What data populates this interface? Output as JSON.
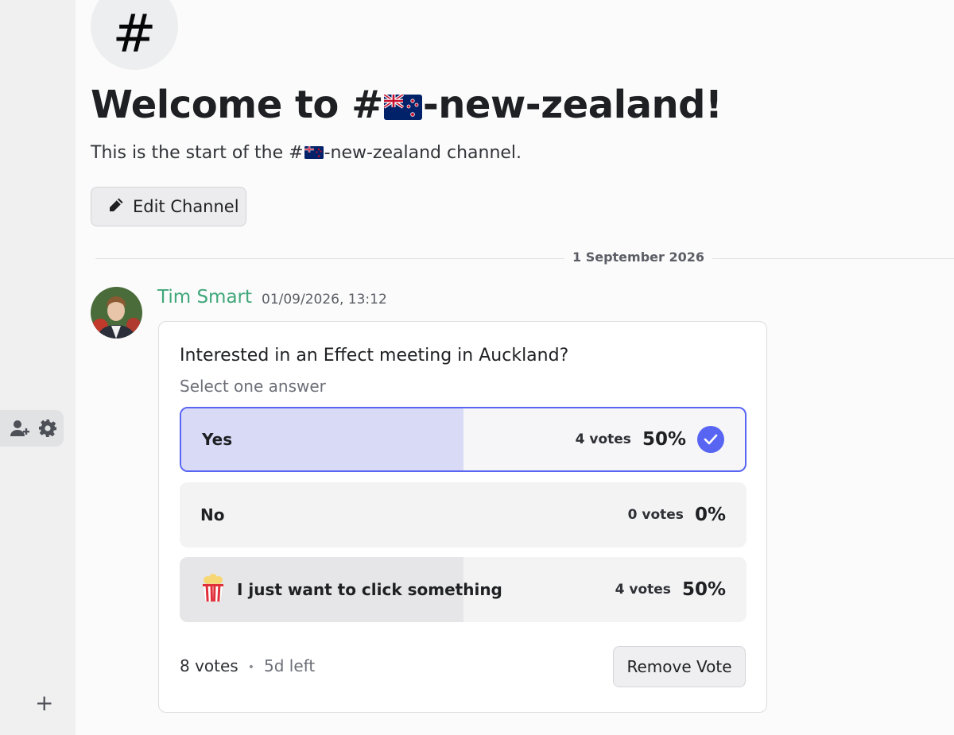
{
  "sidebar": {
    "icons": [
      "add-member-icon",
      "gear-icon"
    ],
    "add_label": "+"
  },
  "channel": {
    "icon_glyph": "#",
    "welcome_prefix": "Welcome to #",
    "welcome_suffix": "-new-zealand!",
    "desc_prefix": "This is the start of the #",
    "desc_suffix": "-new-zealand channel.",
    "flag_emoji": "🇳🇿",
    "edit_label": "Edit Channel"
  },
  "divider": {
    "date": "1 September 2026"
  },
  "message": {
    "author": "Tim Smart",
    "timestamp": "01/09/2026, 13:12",
    "author_color": "#3fa77a"
  },
  "poll": {
    "question": "Interested in an Effect meeting in Auckland?",
    "subtitle": "Select one answer",
    "options": [
      {
        "emoji": "",
        "label": "Yes",
        "votes": "4 votes",
        "percent": "50%",
        "fraction": 0.5,
        "selected": true
      },
      {
        "emoji": "",
        "label": "No",
        "votes": "0 votes",
        "percent": "0%",
        "fraction": 0,
        "selected": false
      },
      {
        "emoji": "🍿",
        "label": "I just want to click something",
        "votes": "4 votes",
        "percent": "50%",
        "fraction": 0.5,
        "selected": false
      }
    ],
    "total_votes": "8 votes",
    "dot": "•",
    "time_left": "5d left",
    "remove_label": "Remove Vote",
    "accent": "#5865f2"
  }
}
